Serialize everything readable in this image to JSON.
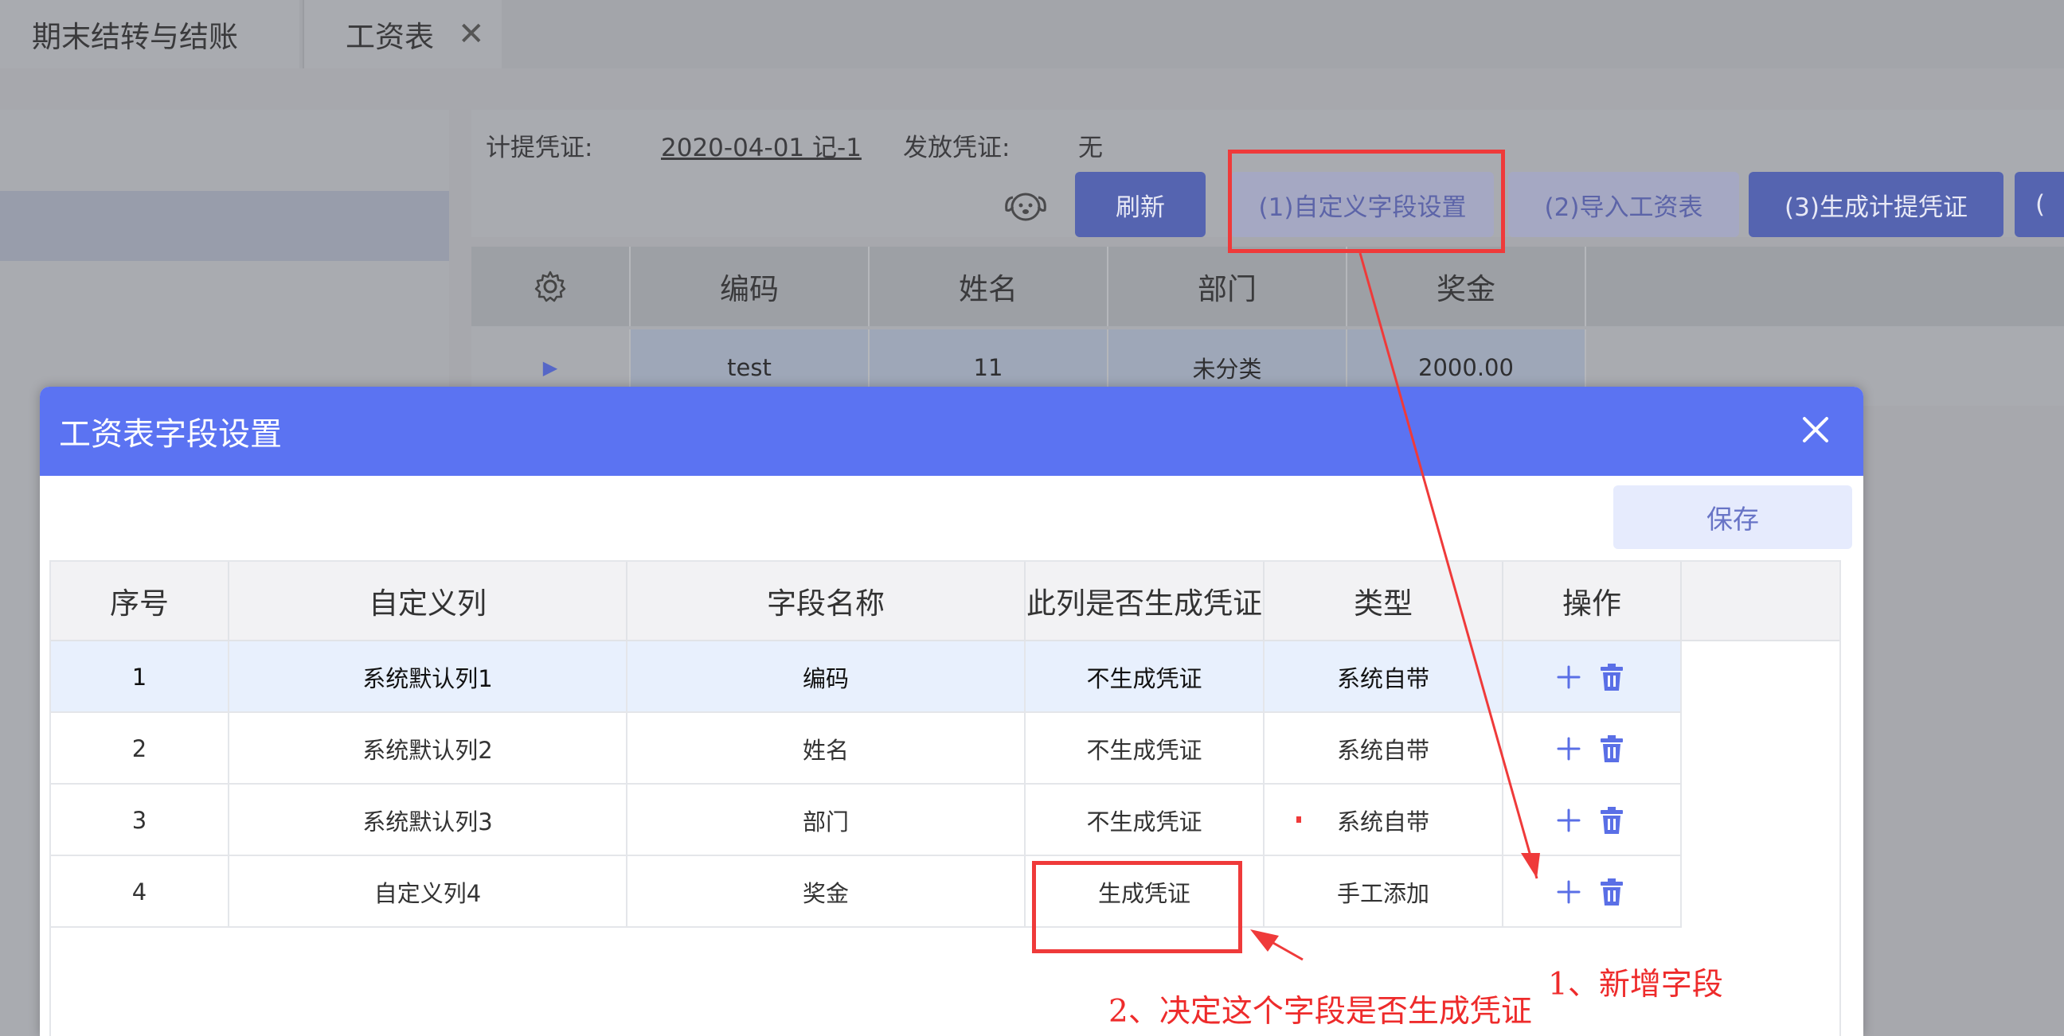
{
  "tabs": [
    {
      "label": "期末结转与结账"
    },
    {
      "label": "工资表",
      "close": "✕"
    }
  ],
  "voucher": {
    "accrual_label": "计提凭证:",
    "accrual_value": "2020-04-01 记-1",
    "payout_label": "发放凭证:",
    "payout_value": "无"
  },
  "toolbar": {
    "refresh": "刷新",
    "custom_fields": "(1)自定义字段设置",
    "import": "(2)导入工资表",
    "gen_accrual": "(3)生成计提凭证",
    "next_cut": "("
  },
  "bg_table": {
    "headers": [
      "编码",
      "姓名",
      "部门",
      "奖金"
    ],
    "row": {
      "marker": "▶",
      "cells": [
        "test",
        "11",
        "未分类",
        "2000.00"
      ]
    }
  },
  "modal": {
    "title": "工资表字段设置",
    "save": "保存",
    "headers": [
      "序号",
      "自定义列",
      "字段名称",
      "此列是否生成凭证",
      "类型",
      "操作"
    ],
    "rows": [
      {
        "no": "1",
        "col": "系统默认列1",
        "name": "编码",
        "voucher": "不生成凭证",
        "type": "系统自带"
      },
      {
        "no": "2",
        "col": "系统默认列2",
        "name": "姓名",
        "voucher": "不生成凭证",
        "type": "系统自带"
      },
      {
        "no": "3",
        "col": "系统默认列3",
        "name": "部门",
        "voucher": "不生成凭证",
        "type": "系统自带"
      },
      {
        "no": "4",
        "col": "自定义列4",
        "name": "奖金",
        "voucher": "生成凭证",
        "type": "手工添加"
      }
    ]
  },
  "annotations": {
    "note1": "1、新增字段",
    "note2": "2、决定这个字段是否生成凭证",
    "color": "#ee2b2b"
  },
  "colors": {
    "header_blue": "#5b73f2",
    "button_blue": "#5564b0"
  }
}
